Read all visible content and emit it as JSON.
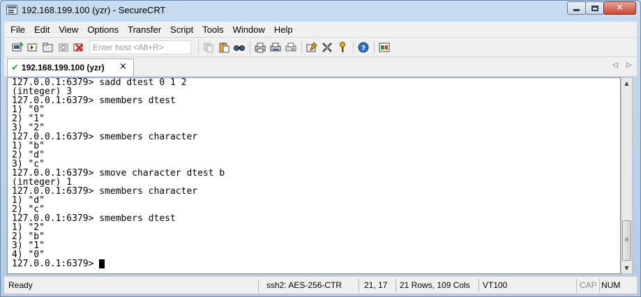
{
  "window": {
    "title": "192.168.199.100 (yzr) - SecureCRT",
    "close_glyph": "✕"
  },
  "menu": [
    "File",
    "Edit",
    "View",
    "Options",
    "Transfer",
    "Script",
    "Tools",
    "Window",
    "Help"
  ],
  "toolbar": {
    "host_placeholder": "Enter host <Alt+R>",
    "icons_left": [
      "connect-icon",
      "quick-connect-icon",
      "connect-tab-icon",
      "reconnect-icon",
      "disconnect-icon"
    ],
    "icons_right": [
      "copy-icon",
      "paste-icon",
      "find-icon",
      "print-icon",
      "print-selection-icon",
      "print-setup-icon",
      "session-options-icon",
      "global-options-icon",
      "keymap-icon",
      "help-icon",
      "sftp-icon"
    ]
  },
  "tab": {
    "check": "✔",
    "label": "192.168.199.100 (yzr)",
    "close": "×",
    "prev": "◁",
    "next": "▷"
  },
  "terminal": {
    "lines": [
      "127.0.0.1:6379> sadd dtest 0 1 2",
      "(integer) 3",
      "127.0.0.1:6379> smembers dtest",
      "1) \"0\"",
      "2) \"1\"",
      "3) \"2\"",
      "127.0.0.1:6379> smembers character",
      "1) \"b\"",
      "2) \"d\"",
      "3) \"c\"",
      "127.0.0.1:6379> smove character dtest b",
      "(integer) 1",
      "127.0.0.1:6379> smembers character",
      "1) \"d\"",
      "2) \"c\"",
      "127.0.0.1:6379> smembers dtest",
      "1) \"2\"",
      "2) \"b\"",
      "3) \"1\"",
      "4) \"0\""
    ],
    "prompt": "127.0.0.1:6379> "
  },
  "status": {
    "state": "Ready",
    "cipher": "ssh2: AES-256-CTR",
    "position": "21,  17",
    "size": "21 Rows, 109 Cols",
    "terminal_type": "VT100",
    "cap": "CAP",
    "num": "NUM"
  }
}
